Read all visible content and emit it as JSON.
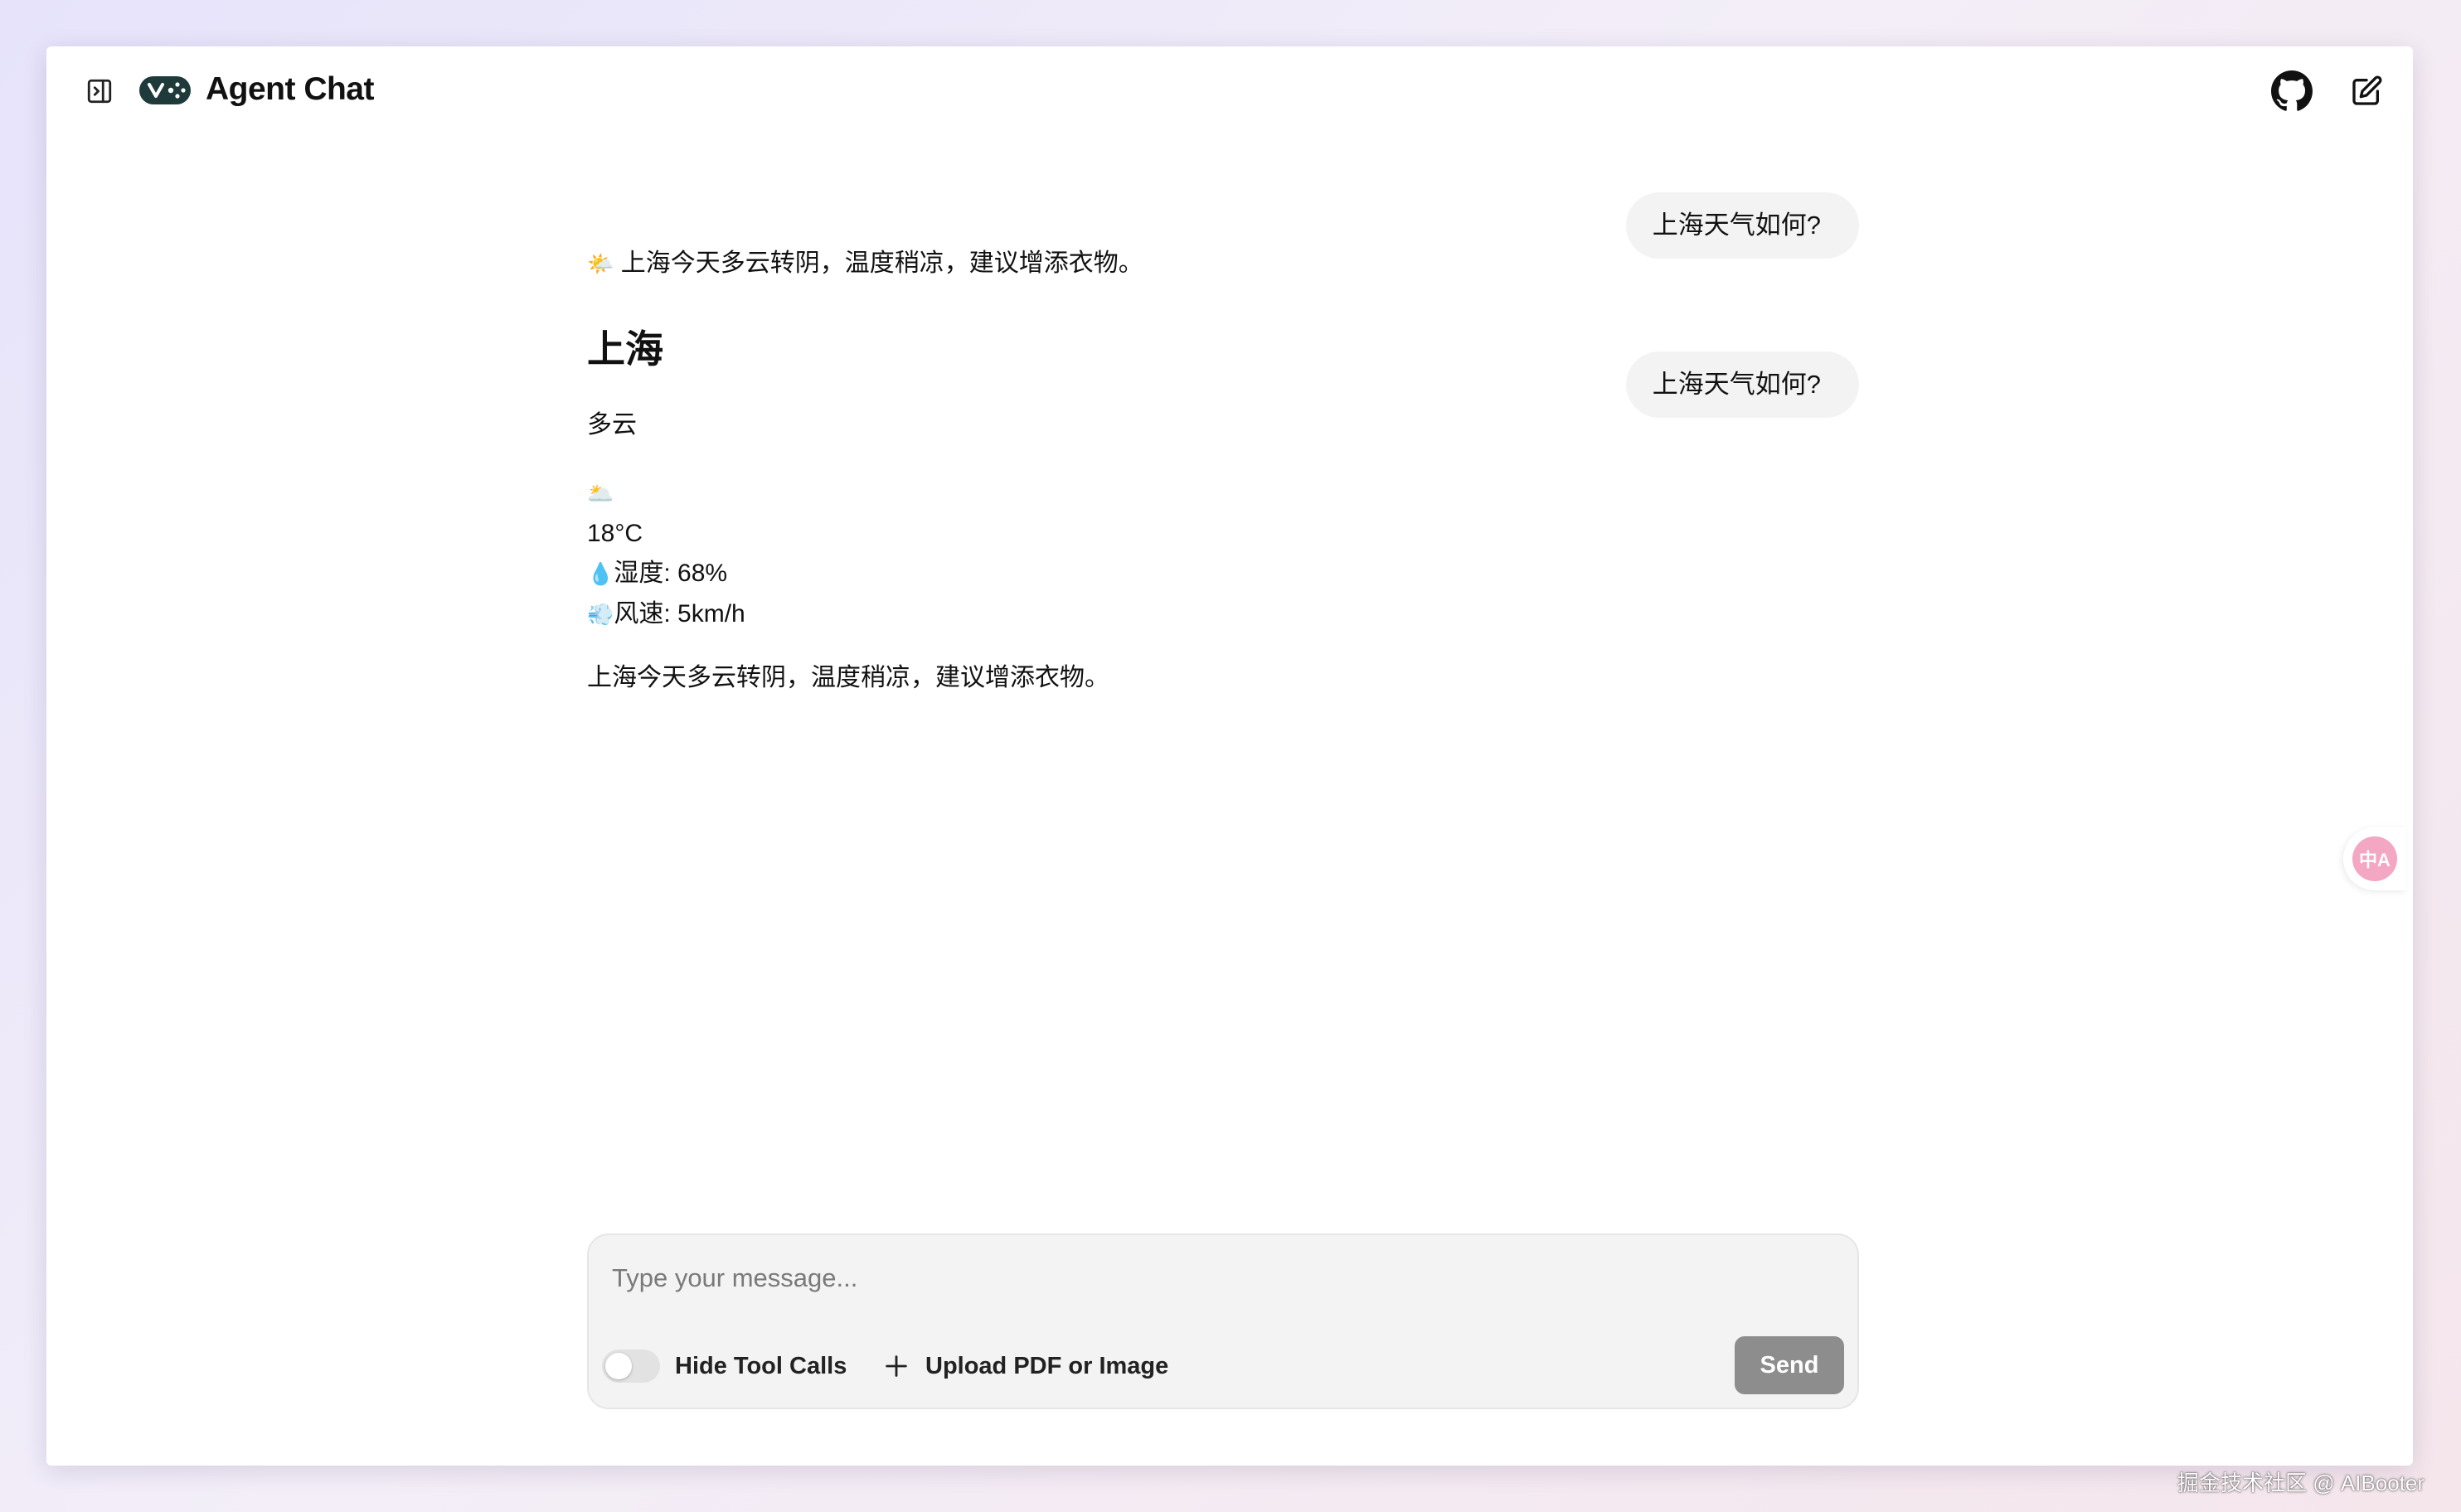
{
  "header": {
    "title": "Agent Chat",
    "icons": {
      "sidebar_toggle": "panel-left-icon",
      "logo": "agent-logo-icon",
      "github": "github-icon",
      "new_chat": "pencil-square-icon"
    }
  },
  "messages": {
    "user": [
      {
        "text": "上海天气如何?"
      },
      {
        "text": "上海天气如何?"
      }
    ],
    "assistant": {
      "summary_emoji": "🌤️",
      "summary_text": "上海今天多云转阴，温度稍凉，建议增添衣物。",
      "city": "上海",
      "condition": "多云",
      "weather_emoji": "🌥️",
      "temperature": "18°C",
      "humidity_emoji": "💧",
      "humidity": "湿度: 68%",
      "wind_emoji": "💨",
      "wind": "风速: 5km/h",
      "closing": "上海今天多云转阴，温度稍凉，建议增添衣物。"
    }
  },
  "composer": {
    "placeholder": "Type your message...",
    "toggle_label": "Hide Tool Calls",
    "toggle_on": false,
    "upload_label": "Upload PDF or Image",
    "send_label": "Send"
  },
  "translate_widget": {
    "label": "中A",
    "icon": "translate-icon",
    "color": "#f3a7c2"
  },
  "watermark": "掘金技术社区 @ AIBooter"
}
